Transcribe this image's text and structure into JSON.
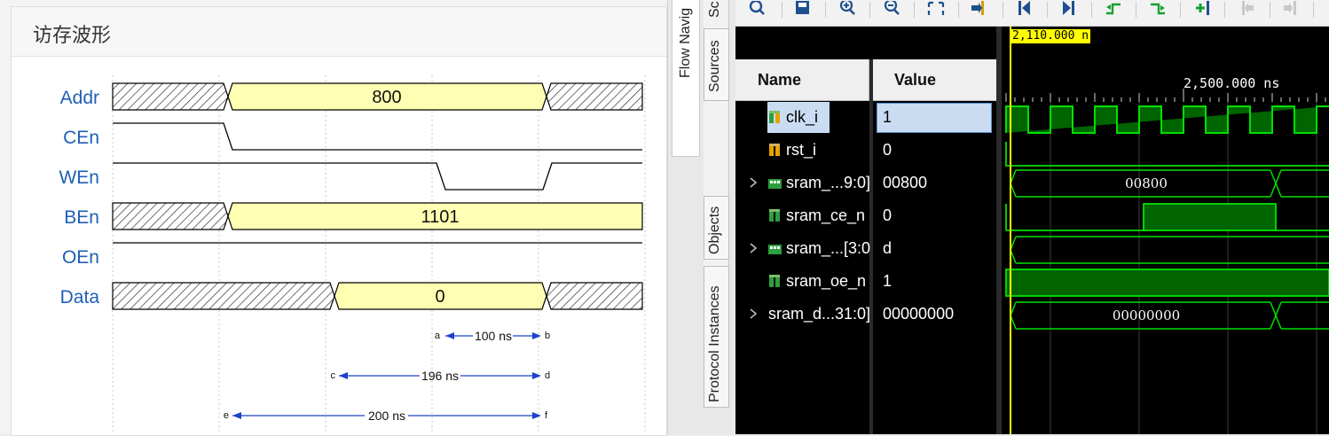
{
  "doc_panel": {
    "title": "访存波形",
    "signals": [
      "Addr",
      "CEn",
      "WEn",
      "BEn",
      "OEn",
      "Data"
    ],
    "bus_values": {
      "addr": "800",
      "ben": "1101",
      "data": "0"
    },
    "annotations": [
      {
        "start_mark": "a",
        "end_mark": "b",
        "label": "100 ns"
      },
      {
        "start_mark": "c",
        "end_mark": "d",
        "label": "196 ns"
      },
      {
        "start_mark": "e",
        "end_mark": "f",
        "label": "200 ns"
      }
    ]
  },
  "side_tabs": {
    "flow_navigator": "Flow Navig",
    "sources_cut": "Sc",
    "sources": "Sources",
    "objects": "Objects",
    "protocol_instances": "Protocol Instances"
  },
  "waveform": {
    "toolbar_icons": [
      "search-icon",
      "save-icon",
      "zoom-in-icon",
      "zoom-out-icon",
      "zoom-fit-icon",
      "go-to-cursor-icon",
      "go-to-start-icon",
      "go-to-end-icon",
      "previous-transition-icon",
      "next-transition-icon",
      "add-marker-icon",
      "previous-marker-icon",
      "next-marker-icon"
    ],
    "cursor_time": "2,110.000 n",
    "ruler_label": "2,500.000 ns",
    "columns": {
      "name": "Name",
      "value": "Value"
    },
    "signals": [
      {
        "name": "clk_i",
        "value": "1",
        "expandable": false,
        "icon": "bit-signal-icon"
      },
      {
        "name": "rst_i",
        "value": "0",
        "expandable": false,
        "icon": "bit-signal-icon"
      },
      {
        "name": "sram_...9:0]",
        "value": "00800",
        "expandable": true,
        "icon": "bus-signal-icon"
      },
      {
        "name": "sram_ce_n",
        "value": "0",
        "expandable": false,
        "icon": "bit-signal-icon"
      },
      {
        "name": "sram_...[3:0",
        "value": "d",
        "expandable": true,
        "icon": "bus-signal-icon"
      },
      {
        "name": "sram_oe_n",
        "value": "1",
        "expandable": false,
        "icon": "bit-signal-icon"
      },
      {
        "name": "sram_d...31:0]",
        "value": "00000000",
        "expandable": true,
        "icon": "none"
      }
    ],
    "wave_bus_labels": {
      "addr": "00800",
      "data": "00000000"
    },
    "colors": {
      "wave": "#00e000",
      "wave_fill": "#006400",
      "cursor": "#ffff00",
      "selection": "#c9dcf2"
    }
  }
}
